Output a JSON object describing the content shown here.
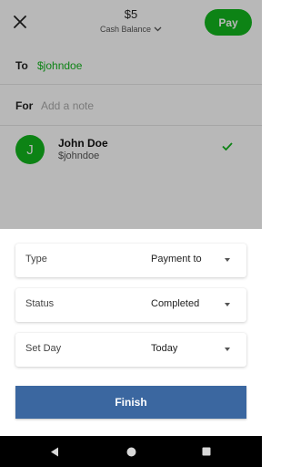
{
  "header": {
    "amount": "$5",
    "balance_label": "Cash Balance",
    "pay_label": "Pay"
  },
  "form": {
    "to_label": "To",
    "to_value": "$johndoe",
    "for_label": "For",
    "note_placeholder": "Add a note"
  },
  "recipient": {
    "initial": "J",
    "name": "John Doe",
    "handle": "$johndoe"
  },
  "sheet": {
    "fields": [
      {
        "label": "Type",
        "value": "Payment to"
      },
      {
        "label": "Status",
        "value": "Completed"
      },
      {
        "label": "Set Day",
        "value": "Today"
      }
    ],
    "finish_label": "Finish"
  },
  "colors": {
    "brand_green": "#13b61e",
    "finish_blue": "#3b67a0"
  }
}
